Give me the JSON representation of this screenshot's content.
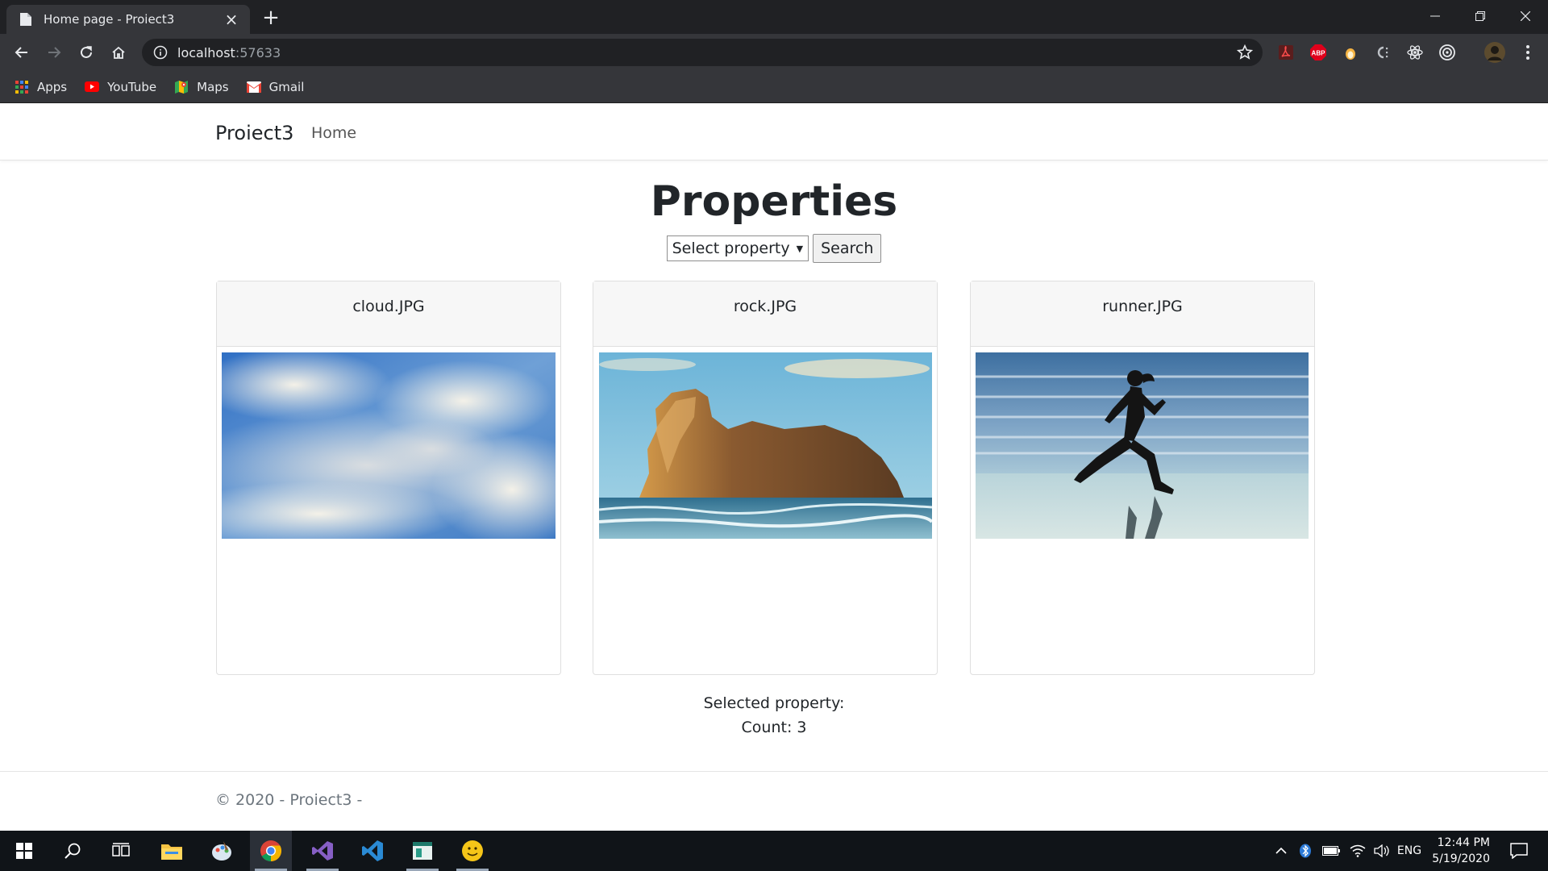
{
  "browser": {
    "tab_title": "Home page - Proiect3",
    "new_tab_symbol": "+",
    "url_host": "localhost",
    "url_port": ":57633",
    "bookmarks": [
      {
        "label": "Apps",
        "icon": "apps-grid-icon"
      },
      {
        "label": "YouTube",
        "icon": "youtube-icon"
      },
      {
        "label": "Maps",
        "icon": "maps-icon"
      },
      {
        "label": "Gmail",
        "icon": "gmail-icon"
      }
    ]
  },
  "navbar": {
    "brand": "Proiect3",
    "home_link": "Home"
  },
  "main": {
    "heading": "Properties",
    "select_value": "Select property",
    "search_label": "Search",
    "cards": [
      {
        "title": "cloud.JPG",
        "image": "cloud-photo"
      },
      {
        "title": "rock.JPG",
        "image": "rock-photo"
      },
      {
        "title": "runner.JPG",
        "image": "runner-photo"
      }
    ],
    "selected_property_label": "Selected property:",
    "count_label": "Count: 3"
  },
  "footer": {
    "text": "© 2020 - Proiect3 -"
  },
  "taskbar": {
    "language": "ENG",
    "time": "12:44 PM",
    "date": "5/19/2020"
  }
}
